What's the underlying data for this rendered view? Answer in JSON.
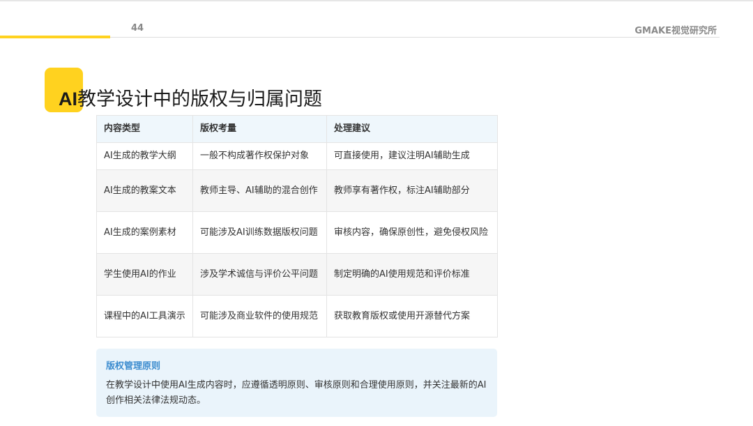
{
  "header": {
    "page_number": "44",
    "brand": "GMAKE视觉研究所",
    "accent_color": "#ffd21f"
  },
  "title": {
    "prefix": "AI",
    "text": "教学设计中的版权与归属问题"
  },
  "table": {
    "headers": [
      "内容类型",
      "版权考量",
      "处理建议"
    ],
    "rows": [
      [
        "AI生成的教学大纲",
        "一般不构成著作权保护对象",
        "可直接使用，建议注明AI辅助生成"
      ],
      [
        "AI生成的教案文本",
        "教师主导、AI辅助的混合创作",
        "教师享有著作权，标注AI辅助部分"
      ],
      [
        "AI生成的案例素材",
        "可能涉及AI训练数据版权问题",
        "审核内容，确保原创性，避免侵权风险"
      ],
      [
        "学生使用AI的作业",
        "涉及学术诚信与评价公平问题",
        "制定明确的AI使用规范和评价标准"
      ],
      [
        "课程中的AI工具演示",
        "可能涉及商业软件的使用规范",
        "获取教育版权或使用开源替代方案"
      ]
    ]
  },
  "principle": {
    "title": "版权管理原则",
    "body": "在教学设计中使用AI生成内容时，应遵循透明原则、审核原则和合理使用原则，并关注最新的AI创作相关法律法规动态。",
    "title_color": "#3c8ccf",
    "background_color": "#eaf4fb"
  }
}
